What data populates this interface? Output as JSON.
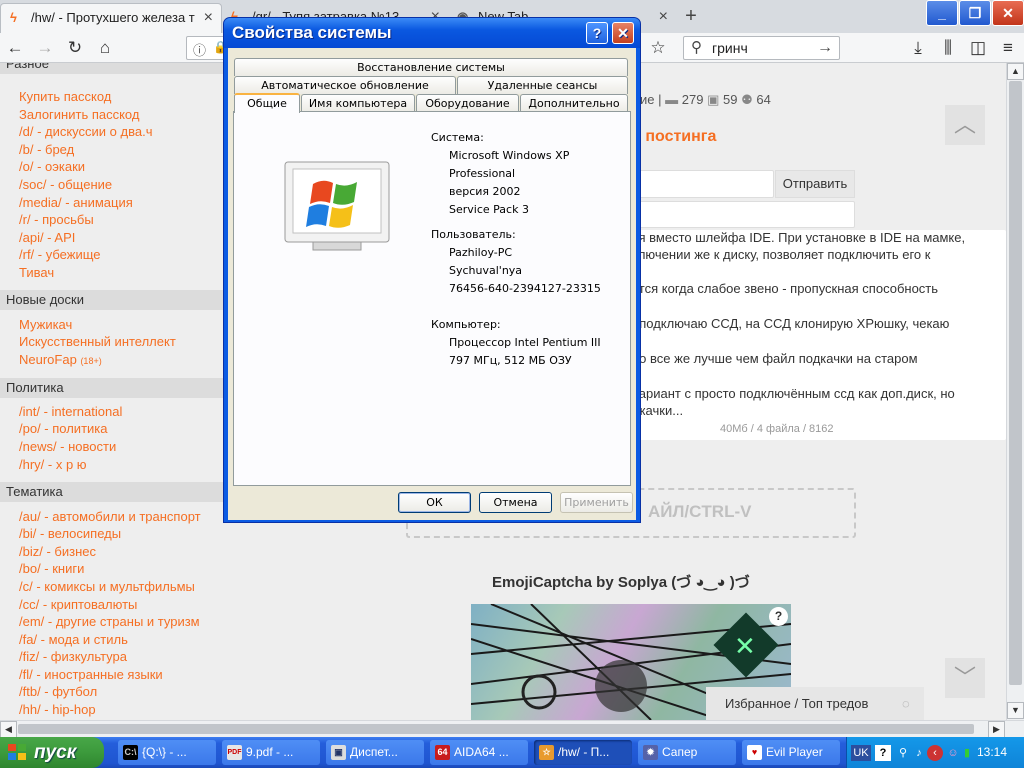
{
  "browser": {
    "tabs": [
      {
        "title": "/hw/ - Протухшего железа т"
      },
      {
        "title": "/gr/ - Тупя затравка №13"
      },
      {
        "title": "New Tab"
      }
    ],
    "new_tab": "+",
    "search_value": "гринч",
    "win_min": "_",
    "win_max": "❐",
    "win_close": "✕"
  },
  "sidebar": {
    "sections": [
      {
        "title": "Разное",
        "items": [
          {
            "label": "Купить пасскод"
          },
          {
            "label": "Залогинить пасскод"
          },
          {
            "label": "/d/ - дискуссии о два.ч"
          },
          {
            "label": "/b/ - бред"
          },
          {
            "label": "/o/ - оэкаки"
          },
          {
            "label": "/soc/ - общение"
          },
          {
            "label": "/media/ - анимация"
          },
          {
            "label": "/r/ - просьбы"
          },
          {
            "label": "/api/ - API"
          },
          {
            "label": "/rf/ - убежище"
          },
          {
            "label": "Тивач"
          }
        ]
      },
      {
        "title": "Новые доски",
        "items": [
          {
            "label": "Мужикач"
          },
          {
            "label": "Искусственный интеллект"
          },
          {
            "label": "NeuroFap",
            "badge": "(18+)"
          }
        ]
      },
      {
        "title": "Политика",
        "items": [
          {
            "label": "/int/ - international"
          },
          {
            "label": "/po/ - политика"
          },
          {
            "label": "/news/ - новости"
          },
          {
            "label": "/hry/ - х р ю"
          }
        ]
      },
      {
        "title": "Тематика",
        "items": [
          {
            "label": "/au/ - автомобили и транспорт"
          },
          {
            "label": "/bi/ - велосипеды"
          },
          {
            "label": "/biz/ - бизнес"
          },
          {
            "label": "/bo/ - книги"
          },
          {
            "label": "/c/ - комиксы и мультфильмы"
          },
          {
            "label": "/cc/ - криптовалюты"
          },
          {
            "label": "/em/ - другие страны и туризм"
          },
          {
            "label": "/fa/ - мода и стиль"
          },
          {
            "label": "/fiz/ - физкультура"
          },
          {
            "label": "/fl/ - иностранные языки"
          },
          {
            "label": "/ftb/ - футбол"
          },
          {
            "label": "/hh/ - hip-hop"
          }
        ]
      }
    ]
  },
  "main": {
    "stats_prefix": "ие |",
    "stat_posts": "279",
    "stat_images": "59",
    "stat_users": "64",
    "heading": "у постинга",
    "send_button": "Отправить",
    "post_lines": [
      "ся вместо шлейфа IDE. При установке в IDE на мамке,",
      "ключении же к диску, позволяет подключить его к",
      "ется когда слабое звено - пропускная способность",
      ", подключаю ССД, на ССД клонирую ХРюшку, чекаю",
      " но все же лучше чем файл подкачки на старом",
      "вариант с просто подключённым ссд как доп.диск, но",
      "дкачки..."
    ],
    "post_meta": "40Мб / 4 файла / 8162",
    "drop_hint": "АЙЛ/CTRL-V",
    "captcha_title": "EmojiCaptcha by Soplya (づ ◕‿◕ )づ",
    "captcha_help": "?",
    "favorites": "Избранное / Топ тредов"
  },
  "dialog": {
    "title": "Свойства системы",
    "help_btn": "?",
    "close_btn": "✕",
    "tabs_row1": [
      "Восстановление системы"
    ],
    "tabs_row2": [
      "Автоматическое обновление",
      "Удаленные сеансы"
    ],
    "tabs_row3": [
      "Общие",
      "Имя компьютера",
      "Оборудование",
      "Дополнительно"
    ],
    "system_label": "Система:",
    "system_lines": [
      "Microsoft Windows XP",
      "Professional",
      "версия 2002",
      "Service Pack 3"
    ],
    "user_label": "Пользователь:",
    "user_lines": [
      "Pazhiloy-PC",
      "Sychuval'nya",
      "76456-640-2394127-23315"
    ],
    "computer_label": "Компьютер:",
    "computer_lines": [
      "Процессор Intel Pentium III",
      "797 МГц, 512 МБ ОЗУ"
    ],
    "ok": "ОК",
    "cancel": "Отмена",
    "apply": "Применить"
  },
  "taskbar": {
    "start": "пуск",
    "tasks": [
      {
        "label": "{Q:\\} - ...",
        "icon": "C:\\"
      },
      {
        "label": "9.pdf - ...",
        "icon": "PDF"
      },
      {
        "label": "Диспет...",
        "icon": "▣"
      },
      {
        "label": "AIDA64 ...",
        "icon": "64"
      },
      {
        "label": "/hw/ - П...",
        "icon": "☆"
      },
      {
        "label": "Сапер",
        "icon": "✹"
      },
      {
        "label": "Evil Player",
        "icon": "♥"
      }
    ],
    "lang": "UK",
    "clock": "13:14"
  },
  "colors": {
    "accent_orange": "#f56f23",
    "xp_blue": "#0b5be3",
    "start_green": "#3c9a3c"
  }
}
